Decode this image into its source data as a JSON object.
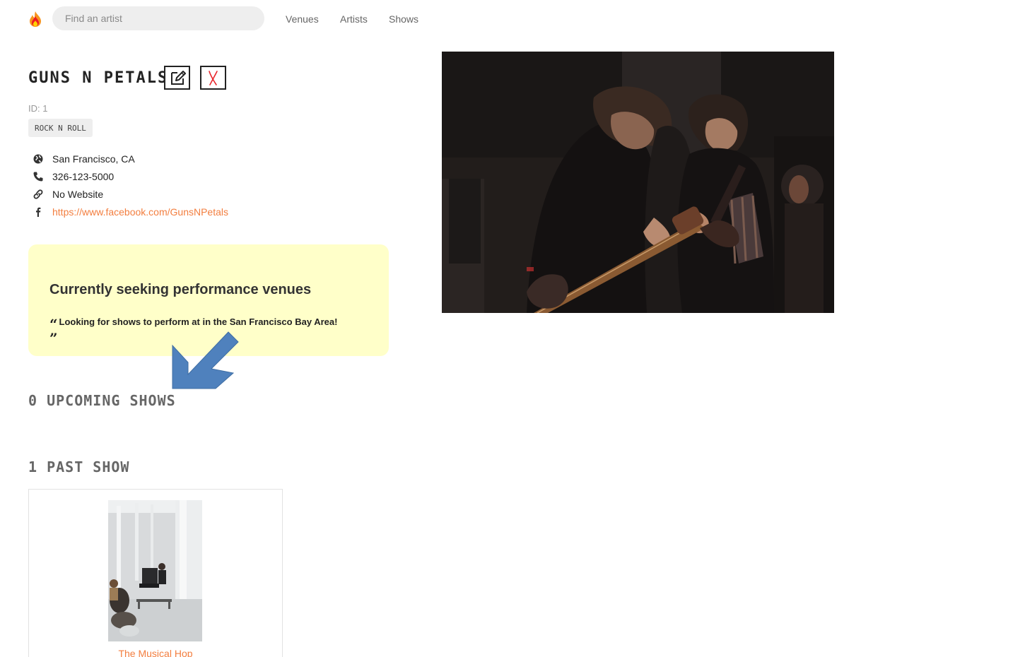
{
  "navbar": {
    "logo_icon": "flame-icon",
    "search_placeholder": "Find an artist",
    "links": [
      "Venues",
      "Artists",
      "Shows"
    ]
  },
  "artist": {
    "name": "GUNS N PETALS",
    "id_text": "ID: 1",
    "genres": [
      "ROCK N ROLL"
    ],
    "city_state": "San Francisco, CA",
    "phone": "326-123-5000",
    "website": "No Website",
    "facebook": "https://www.facebook.com/GunsNPetals",
    "seeking_title": "Currently seeking performance venues",
    "seeking_description": "Looking for shows to perform at in the San Francisco Bay Area!",
    "image": "band-performing-photo"
  },
  "actions": {
    "edit_icon": "edit-icon",
    "delete_icon": "delete-x-icon"
  },
  "upcoming_shows": {
    "heading": "0 UPCOMING SHOWS",
    "items": []
  },
  "past_shows": {
    "heading": "1 PAST SHOW",
    "items": [
      {
        "venue_name": "The Musical Hop",
        "image": "venue-photo"
      }
    ]
  },
  "colors": {
    "accent": "#f37e3f",
    "seeking_bg": "#ffffc9",
    "annotation_arrow": "#4f81bd",
    "delete_red": "#e8262c"
  }
}
